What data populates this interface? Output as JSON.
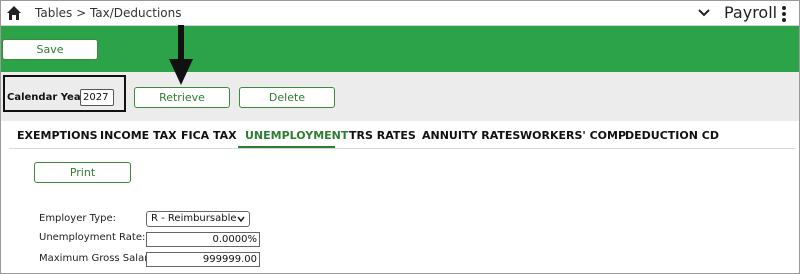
{
  "header": {
    "breadcrumb": "Tables > Tax/Deductions",
    "app_title": "Payroll",
    "icons": {
      "home": "home-icon",
      "chevron": "chevron-down-icon",
      "menu": "vertical-ellipsis-icon"
    }
  },
  "toolbar": {
    "save_label": "Save"
  },
  "calendar": {
    "label": "Calendar Year:",
    "value": "2027",
    "retrieve_label": "Retrieve",
    "delete_label": "Delete"
  },
  "tabs": [
    {
      "label": "EXEMPTIONS"
    },
    {
      "label": "INCOME TAX"
    },
    {
      "label": "FICA TAX"
    },
    {
      "label": "UNEMPLOYMENT"
    },
    {
      "label": "TRS RATES"
    },
    {
      "label": "ANNUITY RATES"
    },
    {
      "label": "WORKERS' COMP"
    },
    {
      "label": "DEDUCTION CD"
    }
  ],
  "active_tab": "UNEMPLOYMENT",
  "print_label": "Print",
  "form": {
    "employer_type_label": "Employer Type:",
    "employer_type_value": "R - Reimbursable",
    "unemployment_rate_label": "Unemployment Rate:",
    "unemployment_rate_value": "0.0000%",
    "max_gross_salary_label": "Maximum Gross Salary:",
    "max_gross_salary_value": "999999.00"
  },
  "colors": {
    "accent_green": "#2ca349",
    "text_green": "#2e7d32"
  }
}
